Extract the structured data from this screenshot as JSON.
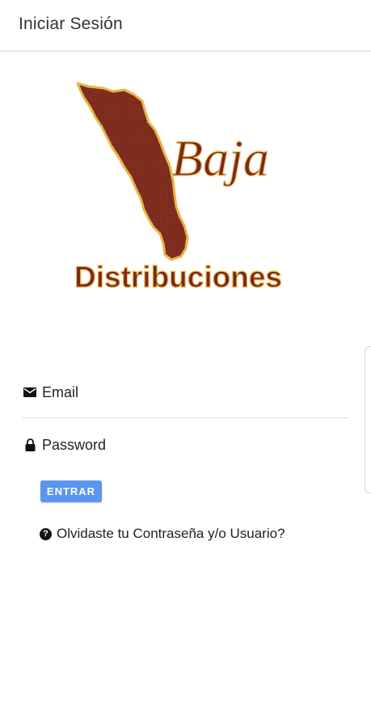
{
  "appbar": {
    "title": "Iniciar Sesión"
  },
  "logo": {
    "word_top": "Baja",
    "word_bottom": "Distribuciones",
    "colors": {
      "map_fill": "#7a2a1c",
      "map_outline": "#e8b44a",
      "text": "#7a2a1c",
      "text_outline": "#f0c060"
    }
  },
  "form": {
    "email": {
      "icon": "envelope-icon",
      "placeholder": "Email",
      "value": ""
    },
    "password": {
      "icon": "lock-icon",
      "placeholder": "Password",
      "value": ""
    },
    "submit_label": "ENTRAR",
    "forgot": {
      "icon": "help-circle-icon",
      "label": "Olvidaste tu Contraseña y/o Usuario?"
    }
  },
  "colors": {
    "accent": "#5b95f0",
    "divider": "#dcdcdc"
  }
}
